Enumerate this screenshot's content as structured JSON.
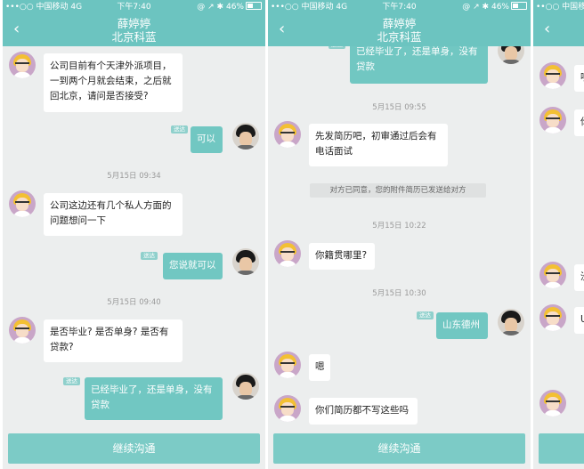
{
  "status_bar": {
    "carrier": "•••○○ 中国移动  4G",
    "carrier_partial": "••○○ 中国移",
    "time": "下午7:40",
    "icons": "@ ↗ ✱",
    "battery": "46%"
  },
  "header": {
    "back_icon": "‹",
    "title": "薛婷婷",
    "subtitle": "北京科蓝"
  },
  "screen1": {
    "msg1": "公司目前有个天津外派项目，一到两个月就会结束，之后就回北京，请问是否接受?",
    "msg2": "可以",
    "time1": "5月15日 09:34",
    "msg3": "公司这边还有几个私人方面的问题想问一下",
    "msg4": "您说就可以",
    "time2": "5月15日 09:40",
    "msg5": "是否毕业? 是否单身? 是否有贷款?",
    "msg6": "已经毕业了，还是单身，没有贷款"
  },
  "screen2": {
    "msg1": "已经毕业了，还是单身，没有贷款",
    "time1": "5月15日 09:55",
    "msg2": "先发简历吧，初审通过后会有电话面试",
    "system": "对方已同意，您的附件简历已发送给对方",
    "time2": "5月15日 10:22",
    "msg3": "你籍贯哪里?",
    "time3": "5月15日 10:30",
    "msg4": "山东德州",
    "msg5": "嗯",
    "msg6": "你们简历都不写这些吗"
  },
  "screen3": {
    "fragments": [
      "嘿",
      "你",
      "没",
      "U"
    ]
  },
  "delivered_tag": "送达",
  "continue_button": "继续沟通",
  "colors": {
    "accent": "#6cc4c0",
    "bubble_out": "#71c7c2",
    "bubble_in": "#ffffff",
    "background": "#eceeee"
  }
}
